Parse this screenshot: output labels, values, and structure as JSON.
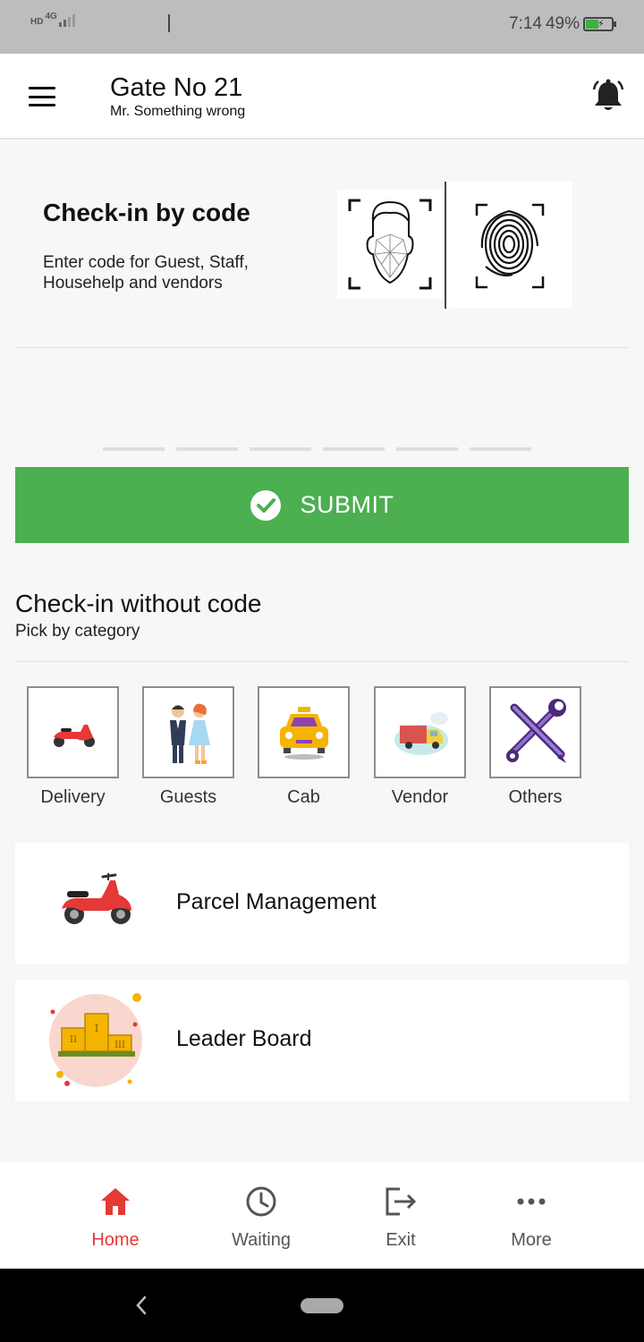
{
  "status_bar": {
    "network": "4G",
    "hd": "HD",
    "time": "7:14",
    "battery": "49%"
  },
  "header": {
    "title": "Gate No 21",
    "subtitle": "Mr. Something wrong"
  },
  "code_checkin": {
    "title": "Check-in  by code",
    "description": "Enter code for Guest, Staff, Househelp and vendors"
  },
  "submit": {
    "label": "SUBMIT",
    "color": "#4caf50"
  },
  "without_code": {
    "title": "Check-in without code",
    "subtitle": "Pick by category"
  },
  "categories": [
    {
      "label": "Delivery",
      "icon": "scooter-icon"
    },
    {
      "label": "Guests",
      "icon": "couple-icon"
    },
    {
      "label": "Cab",
      "icon": "taxi-icon"
    },
    {
      "label": "Vendor",
      "icon": "truck-icon"
    },
    {
      "label": "Others",
      "icon": "tools-icon"
    }
  ],
  "cards": [
    {
      "label": "Parcel Management",
      "icon": "scooter-icon"
    },
    {
      "label": "Leader Board",
      "icon": "podium-icon"
    }
  ],
  "bottom_nav": [
    {
      "label": "Home",
      "icon": "home-icon",
      "active": true
    },
    {
      "label": "Waiting",
      "icon": "clock-icon",
      "active": false
    },
    {
      "label": "Exit",
      "icon": "exit-icon",
      "active": false
    },
    {
      "label": "More",
      "icon": "more-icon",
      "active": false
    }
  ],
  "accent_color": "#e53935"
}
